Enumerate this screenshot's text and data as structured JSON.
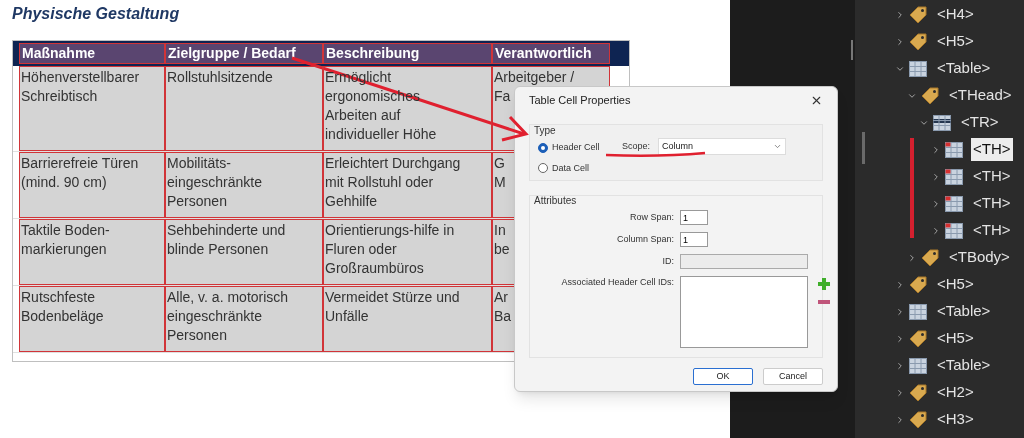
{
  "document": {
    "heading": "Physische Gestaltung",
    "table": {
      "columns": [
        "Maßnahme",
        "Zielgruppe / Bedarf",
        "Beschreibung",
        "Verantwortlich"
      ],
      "rows": [
        [
          "Höhenverstellbarer Schreibtisch",
          "Rollstuhlsitzende",
          "Ermöglicht ergonomisches Arbeiten auf individueller Höhe",
          "Arbeitgeber /\nFa"
        ],
        [
          "Barrierefreie Türen (mind. 90 cm)",
          "Mobilitäts-eingeschränkte Personen",
          "Erleichtert Durchgang mit Rollstuhl oder Gehhilfe",
          "G\nM"
        ],
        [
          "Taktile Boden-markierungen",
          "Sehbehinderte und blinde Personen",
          "Orientierungs-hilfe in Fluren oder Großraumbüros",
          "In\nbe"
        ],
        [
          "Rutschfeste Bodenbeläge",
          "Alle, v. a. motorisch eingeschränkte Personen",
          "Vermeidet Stürze und Unfälle",
          "Ar\nBa"
        ]
      ]
    }
  },
  "dialog": {
    "title": "Table Cell Properties",
    "type_group": {
      "label": "Type",
      "options": [
        {
          "label": "Header Cell",
          "selected": true
        },
        {
          "label": "Data Cell",
          "selected": false
        }
      ],
      "scope": {
        "label": "Scope:",
        "value": "Column"
      }
    },
    "attributes_group": {
      "label": "Attributes",
      "row_span": {
        "label": "Row Span:",
        "value": "1"
      },
      "column_span": {
        "label": "Column Span:",
        "value": "1"
      },
      "id": {
        "label": "ID:",
        "disabled": true
      },
      "associated_header_cell_ids": {
        "label": "Associated Header Cell IDs:"
      }
    },
    "buttons": [
      {
        "label": "OK",
        "default": true
      },
      {
        "label": "Cancel",
        "default": false
      }
    ]
  },
  "tags_tree": {
    "items": [
      {
        "label": "<H4>",
        "kind": "tag",
        "expanded": false,
        "selected": false
      },
      {
        "label": "<H5>",
        "kind": "tag",
        "expanded": false,
        "selected": false
      },
      {
        "label": "<Table>",
        "kind": "table",
        "expanded": true,
        "selected": false,
        "children": [
          {
            "label": "<THead>",
            "kind": "tag",
            "expanded": true,
            "selected": false,
            "children": [
              {
                "label": "<TR>",
                "kind": "row",
                "expanded": true,
                "selected": false,
                "children": [
                  {
                    "label": "<TH>",
                    "kind": "cell",
                    "expanded": false,
                    "selected": true
                  },
                  {
                    "label": "<TH>",
                    "kind": "cell",
                    "expanded": false,
                    "selected": false
                  },
                  {
                    "label": "<TH>",
                    "kind": "cell",
                    "expanded": false,
                    "selected": false
                  },
                  {
                    "label": "<TH>",
                    "kind": "cell",
                    "expanded": false,
                    "selected": false
                  }
                ]
              }
            ]
          },
          {
            "label": "<TBody>",
            "kind": "tag",
            "expanded": false,
            "selected": false
          }
        ]
      },
      {
        "label": "<H5>",
        "kind": "tag",
        "expanded": false,
        "selected": false
      },
      {
        "label": "<Table>",
        "kind": "table",
        "expanded": false,
        "selected": false
      },
      {
        "label": "<H5>",
        "kind": "tag",
        "expanded": false,
        "selected": false
      },
      {
        "label": "<Table>",
        "kind": "table",
        "expanded": false,
        "selected": false
      },
      {
        "label": "<H2>",
        "kind": "tag",
        "expanded": false,
        "selected": false
      },
      {
        "label": "<H3>",
        "kind": "tag",
        "expanded": false,
        "selected": false
      }
    ]
  }
}
